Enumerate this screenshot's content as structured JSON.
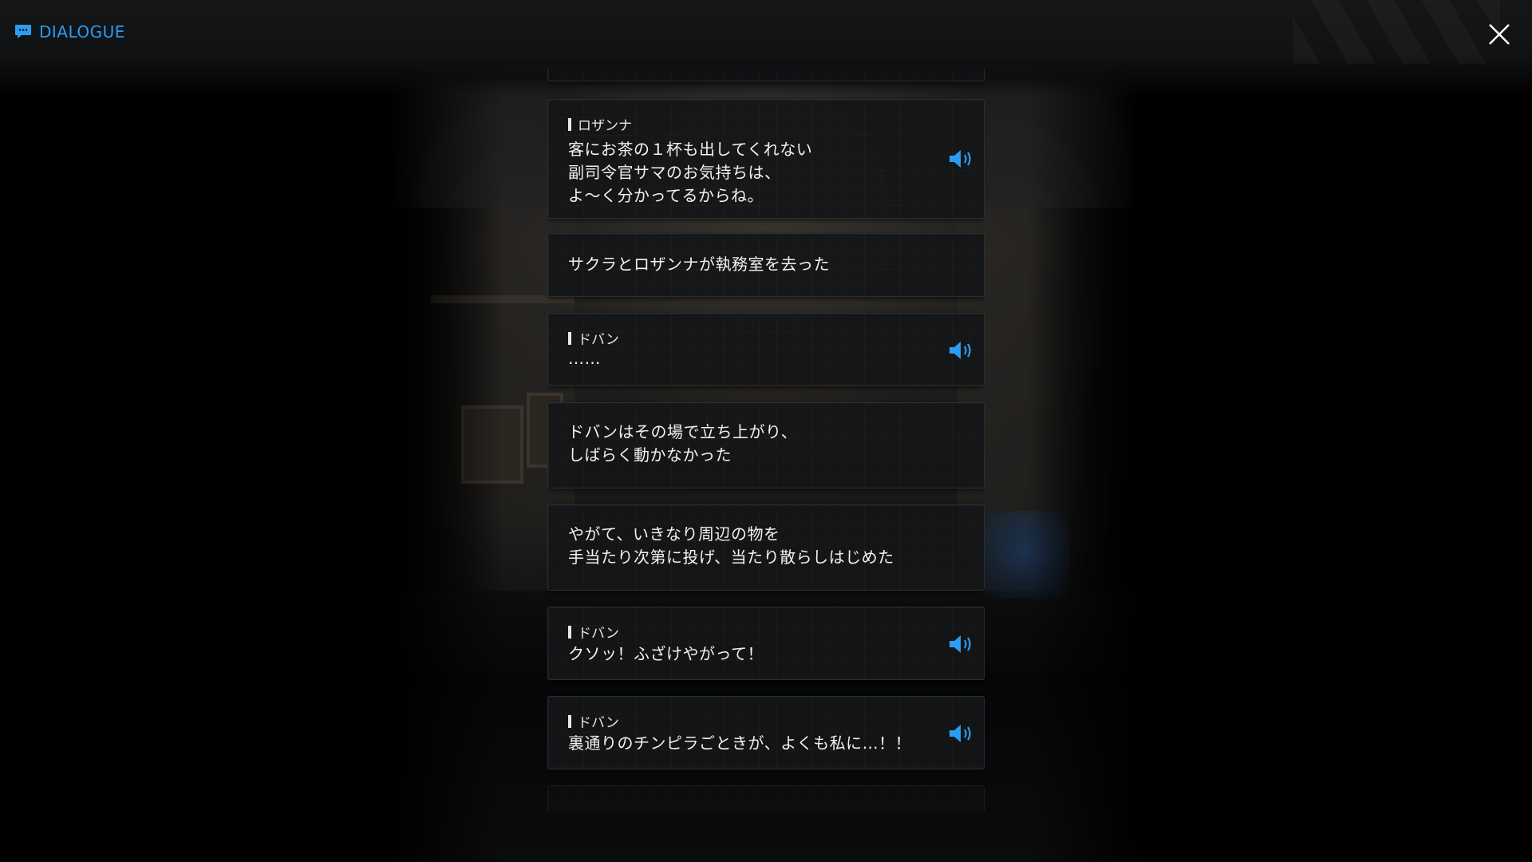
{
  "header": {
    "title": "DIALOGUE",
    "icon": "chat-bubble-icon",
    "close_icon": "close-icon"
  },
  "colors": {
    "accent": "#2a9ef0",
    "panel": "#15171a",
    "text": "#f2f2f2"
  },
  "entries": [
    {
      "speaker": "",
      "text": "",
      "voice": false
    },
    {
      "speaker": "ロザンナ",
      "text": "客にお茶の１杯も出してくれない\n副司令官サマのお気持ちは、\nよ～く分かってるからね。",
      "voice": true
    },
    {
      "speaker": "",
      "text": "サクラとロザンナが執務室を去った",
      "voice": false
    },
    {
      "speaker": "ドバン",
      "text": "……",
      "voice": true
    },
    {
      "speaker": "",
      "text": "ドバンはその場で立ち上がり、\nしばらく動かなかった",
      "voice": false
    },
    {
      "speaker": "",
      "text": "やがて、いきなり周辺の物を\n手当たり次第に投げ、当たり散らしはじめた",
      "voice": false
    },
    {
      "speaker": "ドバン",
      "text": "クソッ！ふざけやがって！",
      "voice": true
    },
    {
      "speaker": "ドバン",
      "text": "裏通りのチンピラごときが、よくも私に…！！",
      "voice": true
    },
    {
      "speaker": "",
      "text": "",
      "voice": false
    }
  ]
}
